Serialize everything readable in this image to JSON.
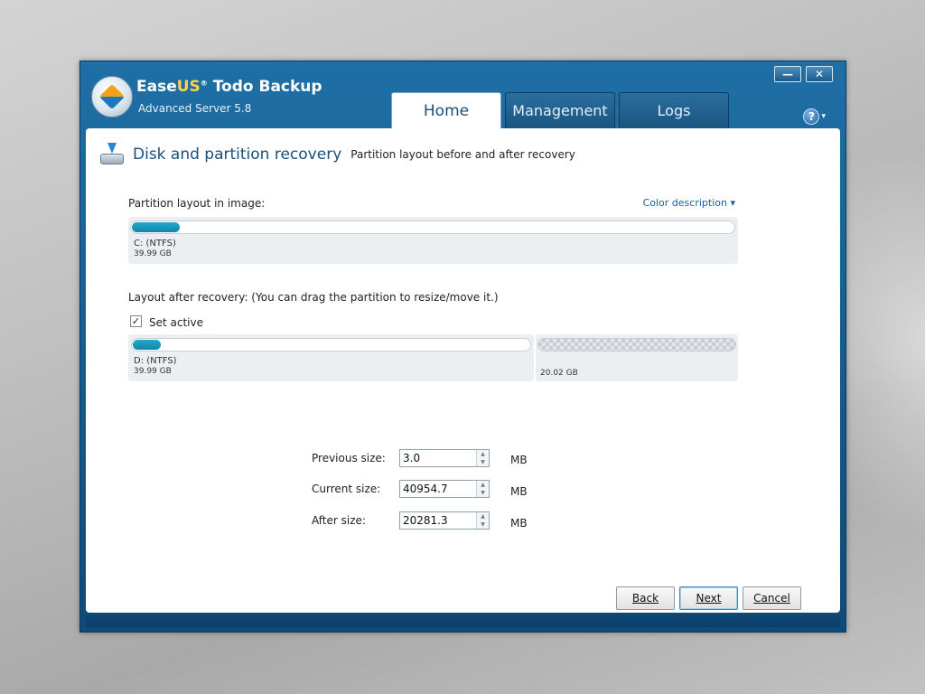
{
  "app": {
    "brand_ease": "Ease",
    "brand_us": "US",
    "brand_reg": "®",
    "brand_rest": " Todo Backup",
    "edition": "Advanced Server 5.8"
  },
  "window_controls": {
    "minimize": "—",
    "close": "✕"
  },
  "tabs": [
    {
      "label": "Home",
      "active": true
    },
    {
      "label": "Management",
      "active": false
    },
    {
      "label": "Logs",
      "active": false
    }
  ],
  "help": {
    "label": "?",
    "caret": "▾"
  },
  "page": {
    "title": "Disk and partition recovery",
    "subtitle": "Partition layout before and after recovery"
  },
  "image_layout": {
    "label": "Partition layout in image:",
    "color_description": "Color description",
    "color_caret": "▾",
    "partition": {
      "name": "C:  (NTFS)",
      "size": "39.99 GB",
      "used_fraction": 0.08
    }
  },
  "after_layout": {
    "label": "Layout after recovery: (You can drag the partition to resize/move it.)",
    "set_active_label": "Set active",
    "set_active_checked": true,
    "check_mark": "✓",
    "partition": {
      "name": "D:  (NTFS)",
      "size": "39.99 GB",
      "used_fraction": 0.07
    },
    "unallocated": {
      "size": "20.02 GB"
    }
  },
  "sizes": {
    "previous": {
      "label": "Previous size:",
      "value": "3.0",
      "unit": "MB"
    },
    "current": {
      "label": "Current size:",
      "value": "40954.7",
      "unit": "MB"
    },
    "after": {
      "label": "After size:",
      "value": "20281.3",
      "unit": "MB"
    },
    "up_arrow": "▲",
    "down_arrow": "▼"
  },
  "buttons": {
    "back": "Back",
    "next": "Next",
    "cancel": "Cancel"
  },
  "colors": {
    "accent": "#1a4f78",
    "bar_fill": "#0e86ab",
    "link": "#1d5fa0"
  }
}
